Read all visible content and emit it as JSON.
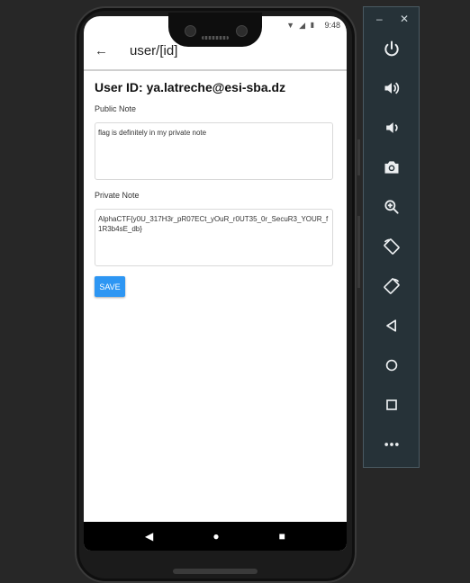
{
  "status_bar": {
    "time": "9:48"
  },
  "app_bar": {
    "back_icon": "arrow-left-icon",
    "title": "user/[id]"
  },
  "page": {
    "heading": "User ID: ya.latreche@esi-sba.dz",
    "public_note": {
      "label": "Public Note",
      "value": "flag is definitely in my private note"
    },
    "private_note": {
      "label": "Private Note",
      "value": "AlphaCTF{y0U_317H3r_pR07ECt_yOuR_r0UT35_0r_SecuR3_YOUR_f1R3b4sE_db}"
    },
    "save_label": "SAVE"
  },
  "nav_bar": {
    "back": "◀",
    "home": "●",
    "recents": "■"
  },
  "emulator_toolbar": {
    "minimize": "–",
    "close": "✕",
    "buttons": [
      "power-icon",
      "volume-up-icon",
      "volume-down-icon",
      "camera-icon",
      "zoom-icon",
      "rotate-left-icon",
      "rotate-right-icon",
      "back-icon",
      "home-icon",
      "overview-icon",
      "more-icon"
    ]
  },
  "colors": {
    "accent": "#2d96f3",
    "toolbar_bg": "#263238",
    "backdrop": "#272727"
  }
}
